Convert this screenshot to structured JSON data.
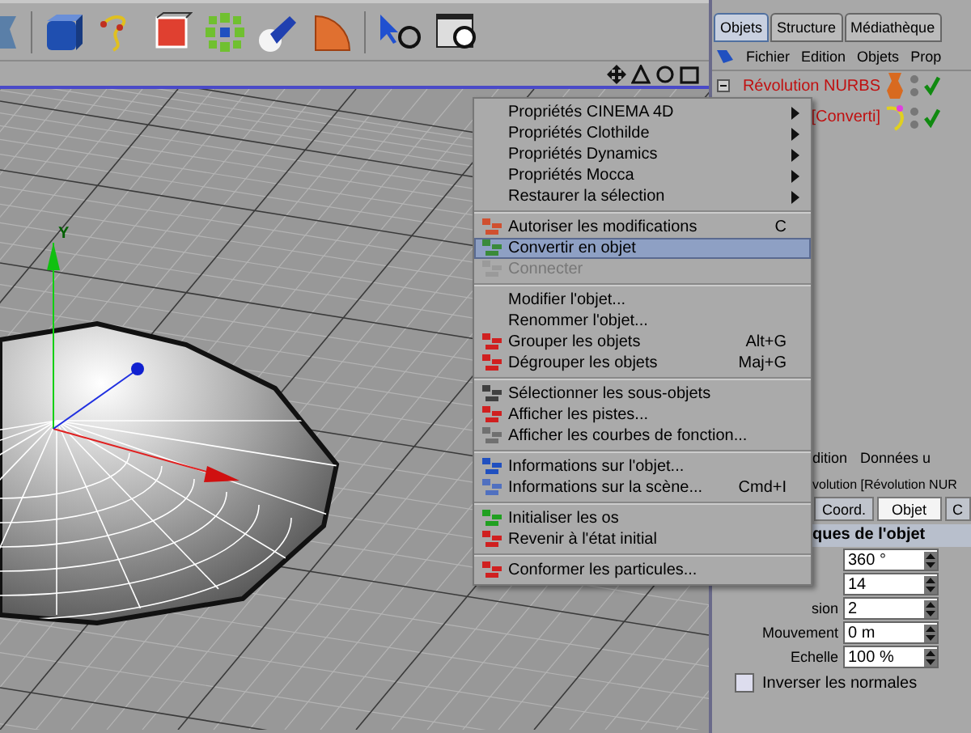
{
  "viewport": {
    "axis_label": "Y"
  },
  "manager_tabs": [
    {
      "label": "Objets",
      "selected": true
    },
    {
      "label": "Structure",
      "selected": false
    },
    {
      "label": "Médiathèque",
      "selected": false
    }
  ],
  "manager_menu": [
    "Fichier",
    "Edition",
    "Objets",
    "Prop"
  ],
  "objects": [
    {
      "name": "Révolution NURBS",
      "expanded": true,
      "checked": true,
      "kind": "nurbs"
    },
    {
      "name": "[Converti]",
      "checked": true,
      "kind": "spline"
    }
  ],
  "context_menu": [
    {
      "kind": "item",
      "label": "Propriétés CINEMA 4D",
      "submenu": true
    },
    {
      "kind": "item",
      "label": "Propriétés Clothilde",
      "submenu": true
    },
    {
      "kind": "item",
      "label": "Propriétés Dynamics",
      "submenu": true
    },
    {
      "kind": "item",
      "label": "Propriétés Mocca",
      "submenu": true
    },
    {
      "kind": "item",
      "label": "Restaurer la sélection",
      "submenu": true
    },
    {
      "kind": "separator"
    },
    {
      "kind": "item",
      "label": "Autoriser les modifications",
      "shortcut": "C",
      "selected": false
    },
    {
      "kind": "item",
      "label": "Convertir en objet",
      "selected": true
    },
    {
      "kind": "item",
      "label": "Connecter",
      "disabled": true
    },
    {
      "kind": "separator"
    },
    {
      "kind": "item",
      "label": "Modifier l'objet..."
    },
    {
      "kind": "item",
      "label": "Renommer l'objet..."
    },
    {
      "kind": "item",
      "label": "Grouper les objets",
      "shortcut": "Alt+G"
    },
    {
      "kind": "item",
      "label": "Dégrouper les objets",
      "shortcut": "Maj+G"
    },
    {
      "kind": "separator"
    },
    {
      "kind": "item",
      "label": "Sélectionner les sous-objets"
    },
    {
      "kind": "item",
      "label": "Afficher les pistes..."
    },
    {
      "kind": "item",
      "label": "Afficher les courbes de fonction..."
    },
    {
      "kind": "separator"
    },
    {
      "kind": "item",
      "label": "Informations sur l'objet..."
    },
    {
      "kind": "item",
      "label": "Informations sur la scène...",
      "shortcut": "Cmd+I"
    },
    {
      "kind": "separator"
    },
    {
      "kind": "item",
      "label": "Initialiser les os"
    },
    {
      "kind": "item",
      "label": "Revenir à l'état initial"
    },
    {
      "kind": "separator"
    },
    {
      "kind": "item",
      "label": "Conformer les particules..."
    }
  ],
  "attributes": {
    "tabs_top": [
      "dition",
      "Données u"
    ],
    "title": "volution [Révolution NUR",
    "tabs": [
      {
        "label": "Coord.",
        "selected": false
      },
      {
        "label": "Objet",
        "selected": true
      },
      {
        "label": "C",
        "selected": false
      }
    ],
    "section": "ques de l'objet",
    "fields": [
      {
        "value": "360 °"
      },
      {
        "value": "14"
      },
      {
        "label": "sion",
        "value": "2"
      },
      {
        "label": "Mouvement",
        "value": "0 m"
      },
      {
        "label": "Echelle",
        "value": "100 %"
      }
    ],
    "checkbox": {
      "label": "Inverser les normales",
      "checked": false
    }
  }
}
